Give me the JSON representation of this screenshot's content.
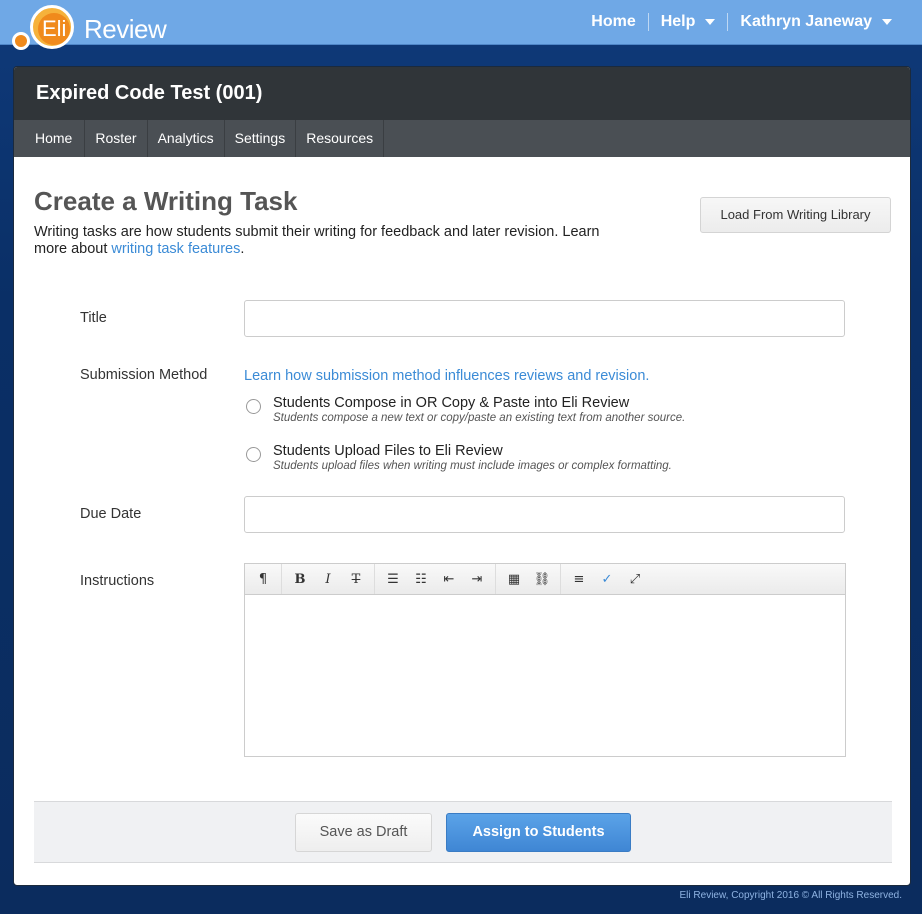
{
  "topbar": {
    "logo_eli": "Eli",
    "logo_review": "Review",
    "nav": [
      {
        "label": "Home"
      },
      {
        "label": "Help"
      },
      {
        "label": "Kathryn Janeway"
      }
    ]
  },
  "course": {
    "title": "Expired Code Test (001)",
    "tabs": [
      {
        "label": "Home"
      },
      {
        "label": "Roster"
      },
      {
        "label": "Analytics"
      },
      {
        "label": "Settings"
      },
      {
        "label": "Resources"
      }
    ]
  },
  "page": {
    "title": "Create a Writing Task",
    "description_text": "Writing tasks are how students submit their writing for feedback and later revision. Learn more about ",
    "description_link": "writing task features",
    "description_end": ".",
    "load_button": "Load From Writing Library"
  },
  "form": {
    "title_label": "Title",
    "title_value": "",
    "submission_label": "Submission Method",
    "submission_link": "Learn how submission method influences reviews and revision.",
    "options": [
      {
        "main": "Students Compose in OR Copy & Paste into Eli Review",
        "sub": "Students compose a new text or copy/paste an existing text from another source."
      },
      {
        "main": "Students Upload Files to Eli Review",
        "sub": "Students upload files when writing must include images or complex formatting."
      }
    ],
    "due_label": "Due Date",
    "due_value": "",
    "instructions_label": "Instructions"
  },
  "toolbar": {
    "paragraph": "¶",
    "bold": "B",
    "italic": "I",
    "strike": "T",
    "bullets": "☰",
    "numbers": "☷",
    "outdent": "⇤",
    "indent": "⇥",
    "table": "▦",
    "link": "⛓",
    "align": "≡",
    "spell": "✓",
    "fullscreen": "⤢"
  },
  "actions": {
    "draft": "Save as Draft",
    "assign": "Assign to Students"
  },
  "footer": {
    "copyright": "Eli Review, Copyright 2016 © All Rights Reserved."
  }
}
